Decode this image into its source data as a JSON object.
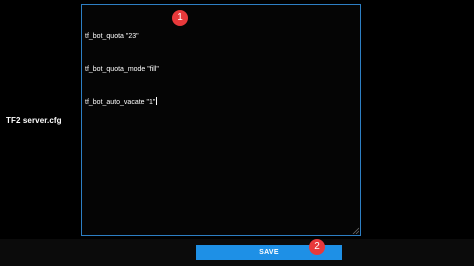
{
  "form": {
    "label": "TF2 server.cfg",
    "editor_lines": [
      "tf_bot_quota \"23\"",
      "tf_bot_quota_mode \"fill\"",
      "tf_bot_auto_vacate \"1\""
    ],
    "save_label": "SAVE"
  },
  "annotations": {
    "badge_1": "1",
    "badge_2": "2"
  },
  "colors": {
    "background": "#000000",
    "editor_border": "#2d7fc4",
    "save_button": "#1e90e6",
    "annotation_badge": "#e8393b"
  }
}
